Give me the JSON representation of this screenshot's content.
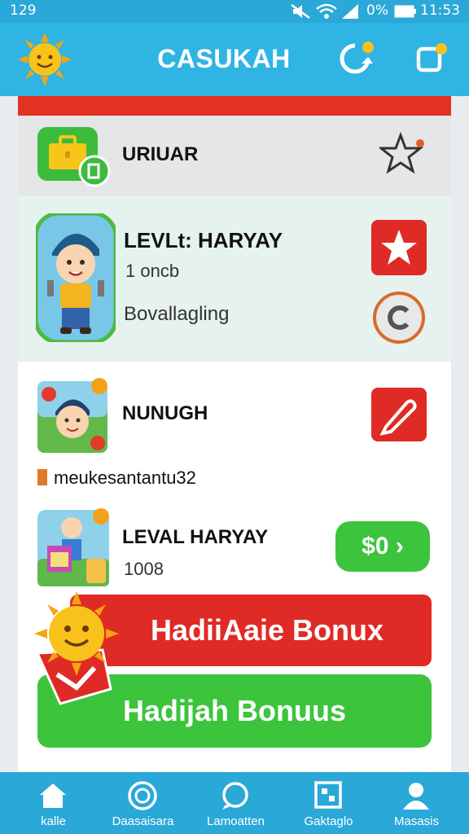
{
  "status_bar": {
    "time_left": "129",
    "battery": "0%",
    "time_right": "11:53"
  },
  "header": {
    "title": "CASUKAH",
    "icons": [
      "sun-mascot-icon",
      "refresh-badge-icon",
      "square-badge-icon"
    ]
  },
  "list": {
    "section_title": "URIUAR",
    "item1": {
      "title": "LEVLt: HARYAY",
      "subtitle": "1 oncb",
      "detail": "Bovallagling"
    },
    "item2": {
      "title": "NUNUGH",
      "note": "meukesantantu32"
    },
    "item3": {
      "title": "LEVAL HARYAY",
      "subtitle": "1008",
      "price_label": "$0 ›"
    }
  },
  "buttons": {
    "bonus_red": "HadiiAaie Bonux",
    "bonus_green": "Hadijah Bonuus"
  },
  "nav": {
    "items": [
      {
        "label": "kalle",
        "icon": "home-icon"
      },
      {
        "label": "Daasaisara",
        "icon": "compass-icon"
      },
      {
        "label": "Lamoatten",
        "icon": "chat-bubble-icon"
      },
      {
        "label": "Gaktaglo",
        "icon": "grid-icon"
      },
      {
        "label": "Masasis",
        "icon": "profile-icon"
      }
    ]
  },
  "colors": {
    "header_blue": "#2fb4e3",
    "accent_red": "#e02a25",
    "accent_green": "#3cc43c",
    "sun_yellow": "#f8c21a"
  }
}
